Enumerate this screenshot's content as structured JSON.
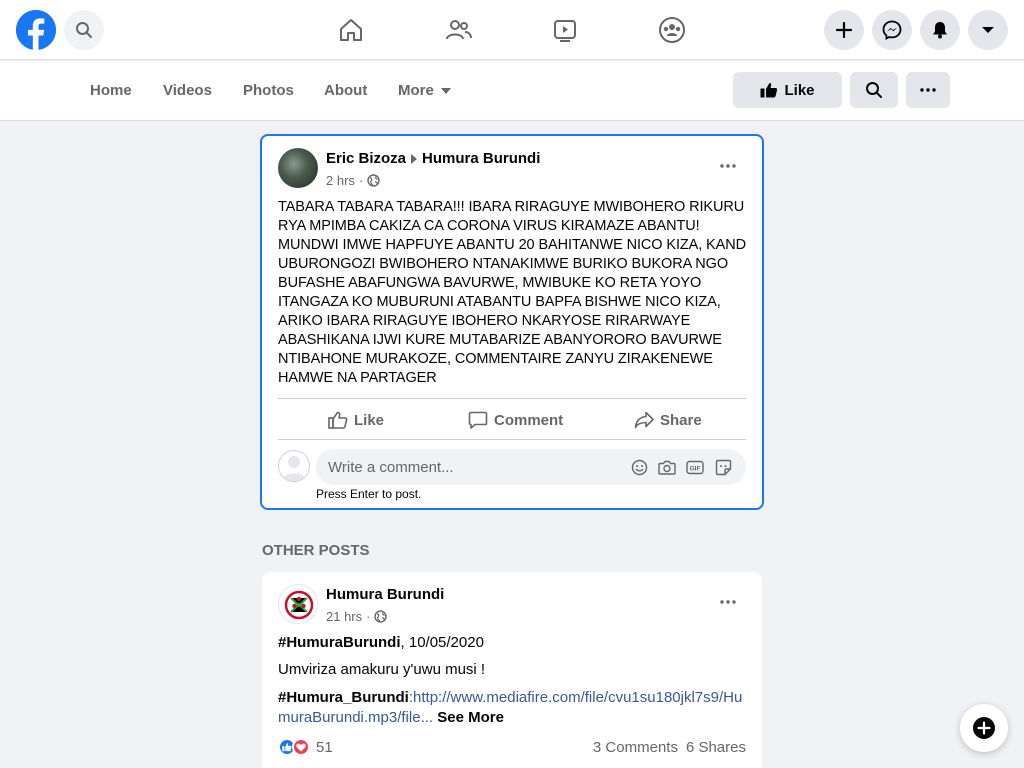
{
  "topbar": {
    "icons": [
      "facebook-logo",
      "search-icon",
      "home-icon",
      "friends-icon",
      "watch-icon",
      "groups-icon",
      "plus-icon",
      "messenger-icon",
      "notifications-icon",
      "dropdown-icon"
    ]
  },
  "page_nav": {
    "tabs": [
      {
        "label": "Home"
      },
      {
        "label": "Videos"
      },
      {
        "label": "Photos"
      },
      {
        "label": "About"
      },
      {
        "label": "More"
      }
    ],
    "like_button": "Like"
  },
  "post": {
    "author": "Eric Bizoza",
    "target_page": "Humura Burundi",
    "time": "2 hrs",
    "privacy": "·",
    "text": "TABARA TABARA TABARA!!! IBARA RIRAGUYE MWIBOHERO RIKURU RYA MPIMBA CAKIZA CA CORONA VIRUS KIRAMAZE ABANTU! MUNDWI IMWE HAPFUYE ABANTU 20 BAHITANWE NICO KIZA, KAND UBURONGOZI BWIBOHERO NTANAKIMWE BURIKO BUKORA NGO BUFASHE ABAFUNGWA BAVURWE, MWIBUKE KO RETA YOYO ITANGAZA KO MUBURUNI ATABANTU BAPFA BISHWE NICO KIZA, ARIKO IBARA RIRAGUYE IBOHERO NKARYOSE RIRARWAYE ABASHIKANA IJWI KURE MUTABARIZE ABANYORORO BAVURWE NTIBAHONE MURAKOZE, COMMENTAIRE ZANYU ZIRAKENEWE HAMWE NA PARTAGER",
    "actions": {
      "like": "Like",
      "comment": "Comment",
      "share": "Share"
    },
    "comment_placeholder": "Write a comment...",
    "press_enter": "Press Enter to post."
  },
  "other_posts": {
    "section_label": "OTHER POSTS",
    "post": {
      "author": "Humura Burundi",
      "time": "21 hrs",
      "privacy": "·",
      "hashtag1": "#HumuraBurundi",
      "date": ",  10/05/2020",
      "line2": "Umviriza amakuru y'uwu musi !",
      "hashtag2": "#Humura_Burundi",
      "link": ":http://www.mediafire.com/file/cvu1su180jkl7s9/HumuraBurundi.mp3/file",
      "ellipsis": "...",
      "see_more": "See More",
      "reaction_count": "51",
      "comments": "3 Comments",
      "shares": "6 Shares"
    }
  },
  "colors": {
    "brand": "#1877f2",
    "link": "#385898",
    "secondary_text": "#65676b"
  }
}
